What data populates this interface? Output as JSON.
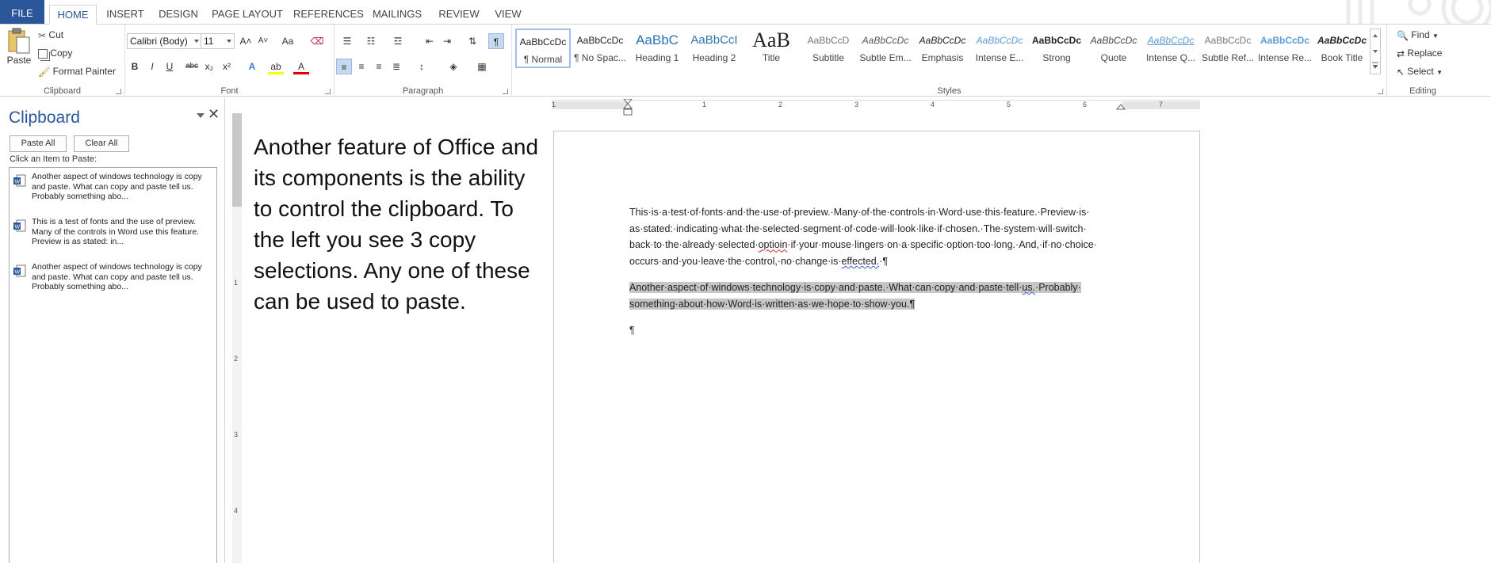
{
  "tabs": [
    "FILE",
    "HOME",
    "INSERT",
    "DESIGN",
    "PAGE LAYOUT",
    "REFERENCES",
    "MAILINGS",
    "REVIEW",
    "VIEW"
  ],
  "clipboard_group": {
    "paste": "Paste",
    "cut": "Cut",
    "copy": "Copy",
    "format_painter": "Format Painter",
    "label": "Clipboard"
  },
  "font_group": {
    "font_name": "Calibri (Body)",
    "font_size": "11",
    "grow": "A˄",
    "shrink": "A˅",
    "change_case": "Aa",
    "bold": "B",
    "italic": "I",
    "underline": "U",
    "strike": "abc",
    "subscript": "x₂",
    "superscript": "x²",
    "label": "Font"
  },
  "paragraph_group": {
    "label": "Paragraph"
  },
  "styles_group": {
    "label": "Styles",
    "items": [
      {
        "sample": "AaBbCcDc",
        "name": "¶ Normal"
      },
      {
        "sample": "AaBbCcDc",
        "name": "¶ No Spac..."
      },
      {
        "sample": "AaBbC",
        "name": "Heading 1"
      },
      {
        "sample": "AaBbCcI",
        "name": "Heading 2"
      },
      {
        "sample": "AaB",
        "name": "Title"
      },
      {
        "sample": "AaBbCcD",
        "name": "Subtitle"
      },
      {
        "sample": "AaBbCcDc",
        "name": "Subtle Em..."
      },
      {
        "sample": "AaBbCcDc",
        "name": "Emphasis"
      },
      {
        "sample": "AaBbCcDc",
        "name": "Intense E..."
      },
      {
        "sample": "AaBbCcDc",
        "name": "Strong"
      },
      {
        "sample": "AaBbCcDc",
        "name": "Quote"
      },
      {
        "sample": "AaBbCcDc",
        "name": "Intense Q..."
      },
      {
        "sample": "AaBbCcDc",
        "name": "Subtle Ref..."
      },
      {
        "sample": "AaBbCcDc",
        "name": "Intense Re..."
      },
      {
        "sample": "AaBbCcDc",
        "name": "Book Title"
      }
    ]
  },
  "editing_group": {
    "find": "Find",
    "replace": "Replace",
    "select": "Select",
    "label": "Editing"
  },
  "clipboard_pane": {
    "title": "Clipboard",
    "paste_all": "Paste All",
    "clear_all": "Clear All",
    "hint": "Click an Item to Paste:",
    "items": [
      "Another aspect of windows technology is copy and paste. What can copy and paste tell us. Probably something abo...",
      "This is a test of fonts and the use of preview. Many of the controls in Word use this feature. Preview is as stated: in...",
      "Another aspect of windows technology is copy and paste. What can copy and paste tell us. Probably something abo..."
    ]
  },
  "overlay_text": "Another feature of Office and its components is the ability to control the clipboard. To the left you see 3 copy selections. Any one of these can be used to paste.",
  "ruler": {
    "h_numbers": [
      "1",
      "1",
      "2",
      "3",
      "4",
      "5",
      "6",
      "7"
    ],
    "v_numbers": [
      "1",
      "2",
      "3",
      "4"
    ]
  },
  "document": {
    "para1_lines": [
      "This·is·a·test·of·fonts·and·the·use·of·preview.·Many·of·the·controls·in·Word·use·this·feature.·Preview·is·",
      "as·stated:·indicating·what·the·selected·segment·of·code·will·look·like·if·chosen.·The·system·will·switch·",
      "back·to·the·already·selected·",
      "optioin",
      "·if·your·mouse·lingers·on·a·specific·option·too·long.·And,·if·no·choice·",
      "occurs·and·you·leave·the·control,·no·change·is·",
      "effected.",
      "·¶"
    ],
    "para2_lines": [
      "Another·aspect·of·windows·technology·is·copy·and·paste.·What·can·copy·and·paste·tell·",
      "us.",
      "·Probably·",
      "something·about·how·Word·is·written·as·we·hope·to·show·you.¶"
    ],
    "para3": "¶"
  },
  "colors": {
    "accent": "#2b579a",
    "selection": "#c6c6c6"
  }
}
